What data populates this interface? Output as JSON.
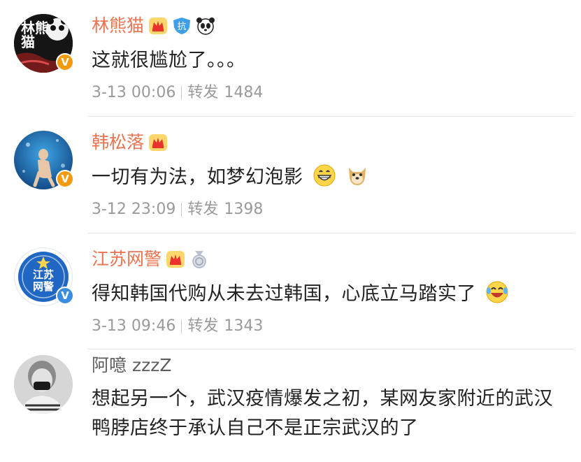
{
  "comments": [
    {
      "username": "林熊猫",
      "text": "这就很尴尬了。。。",
      "time": "3-13 00:06",
      "repost_label": "转发",
      "repost_count": "1484",
      "avatar_text": "林熊猫",
      "verified_color": "#f59a0c",
      "badges": [
        "crown-icon",
        "anti-badge-icon",
        "panda-icon"
      ],
      "badge_anti_text": "抗"
    },
    {
      "username": "韩松落",
      "text": "一切有为法，如梦幻泡影",
      "time": "3-12 23:09",
      "repost_label": "转发",
      "repost_count": "1398",
      "verified_color": "#f59a0c",
      "badges": [
        "crown-icon"
      ],
      "emojis": [
        "grin-emoji",
        "doge-emoji"
      ]
    },
    {
      "username": "江苏网警",
      "text": "得知韩国代购从未去过韩国，心底立马踏实了",
      "time": "3-13 09:46",
      "repost_label": "转发",
      "repost_count": "1343",
      "avatar_text_1": "江苏",
      "avatar_text_2": "网警",
      "verified_color": "#3b8de0",
      "badges": [
        "crown-icon",
        "medal-icon"
      ],
      "emojis": [
        "laugh-cry-emoji"
      ]
    },
    {
      "username": "阿噫 zzzZ",
      "text": "想起另一个，武汉疫情爆发之初，某网友家附近的武汉鸭脖店终于承认自己不是正宗武汉的了"
    }
  ]
}
